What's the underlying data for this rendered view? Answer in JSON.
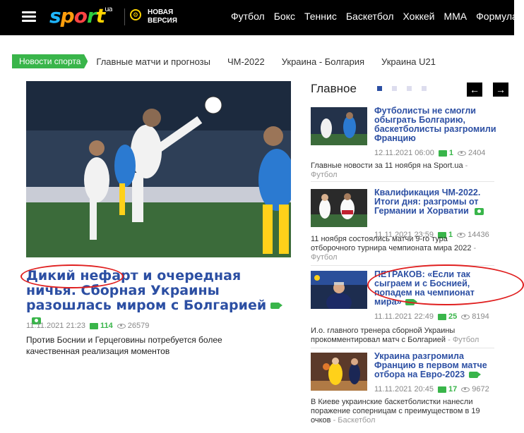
{
  "header": {
    "logo_main": "sport",
    "logo_suffix": "ua",
    "new_version_label_1": "НОВАЯ",
    "new_version_label_2": "ВЕРСИЯ",
    "nav": [
      "Футбол",
      "Бокс",
      "Теннис",
      "Баскетбол",
      "Хоккей",
      "ММА",
      "Формула"
    ]
  },
  "tagbar": {
    "active": "Новости спорта",
    "links": [
      "Главные матчи и прогнозы",
      "ЧМ-2022",
      "Украина - Болгария",
      "Украина U21"
    ]
  },
  "main_story": {
    "title_part1": "Дикий нефарт",
    "title_part2": " и очередная ничья. Сборная Украины разошлась миром с Болгарией",
    "date": "11.11.2021 21:23",
    "comments": "114",
    "views": "26579",
    "lead": "Против Боснии и Герцеговины потребуется более качественная реализация моментов"
  },
  "sidebar": {
    "title": "Главное",
    "cards": [
      {
        "title": "Футболисты не смогли обыграть Болгарию, баскетболисты разгромили Францию",
        "date": "12.11.2021 06:00",
        "comments": "1",
        "views": "2404",
        "desc": "Главные новости за 11 ноября на Sport.ua",
        "category": " - Футбол"
      },
      {
        "title": "Квалификация ЧМ-2022. Итоги дня: разгромы от Германии и Хорватии",
        "date": "11.11.2021 23:59",
        "comments": "1",
        "views": "14436",
        "desc": "11 ноября состоялись матчи 9-го тура отборочного турнира чемпионата мира 2022",
        "category": " - Футбол"
      },
      {
        "title": "ПЕТРАКОВ: «Если так сыграем и с Боснией, попадем на чемпионат мира»",
        "date": "11.11.2021 22:49",
        "comments": "25",
        "views": "8194",
        "desc": "И.о. главного тренера сборной Украины прокомментировал матч с Болгарией",
        "category": " - Футбол"
      },
      {
        "title": "Украина разгромила Францию в первом матче отбора на Евро-2023",
        "date": "11.11.2021 20:45",
        "comments": "17",
        "views": "9672",
        "desc": "В Киеве украинские баскетболистки нанесли поражение соперницам с преимуществом в 19 очков",
        "category": " - Баскетбол"
      }
    ]
  },
  "colors": {
    "accent_green": "#39b54a",
    "link_blue": "#2c4fa3",
    "annotation_red": "#e02020"
  }
}
